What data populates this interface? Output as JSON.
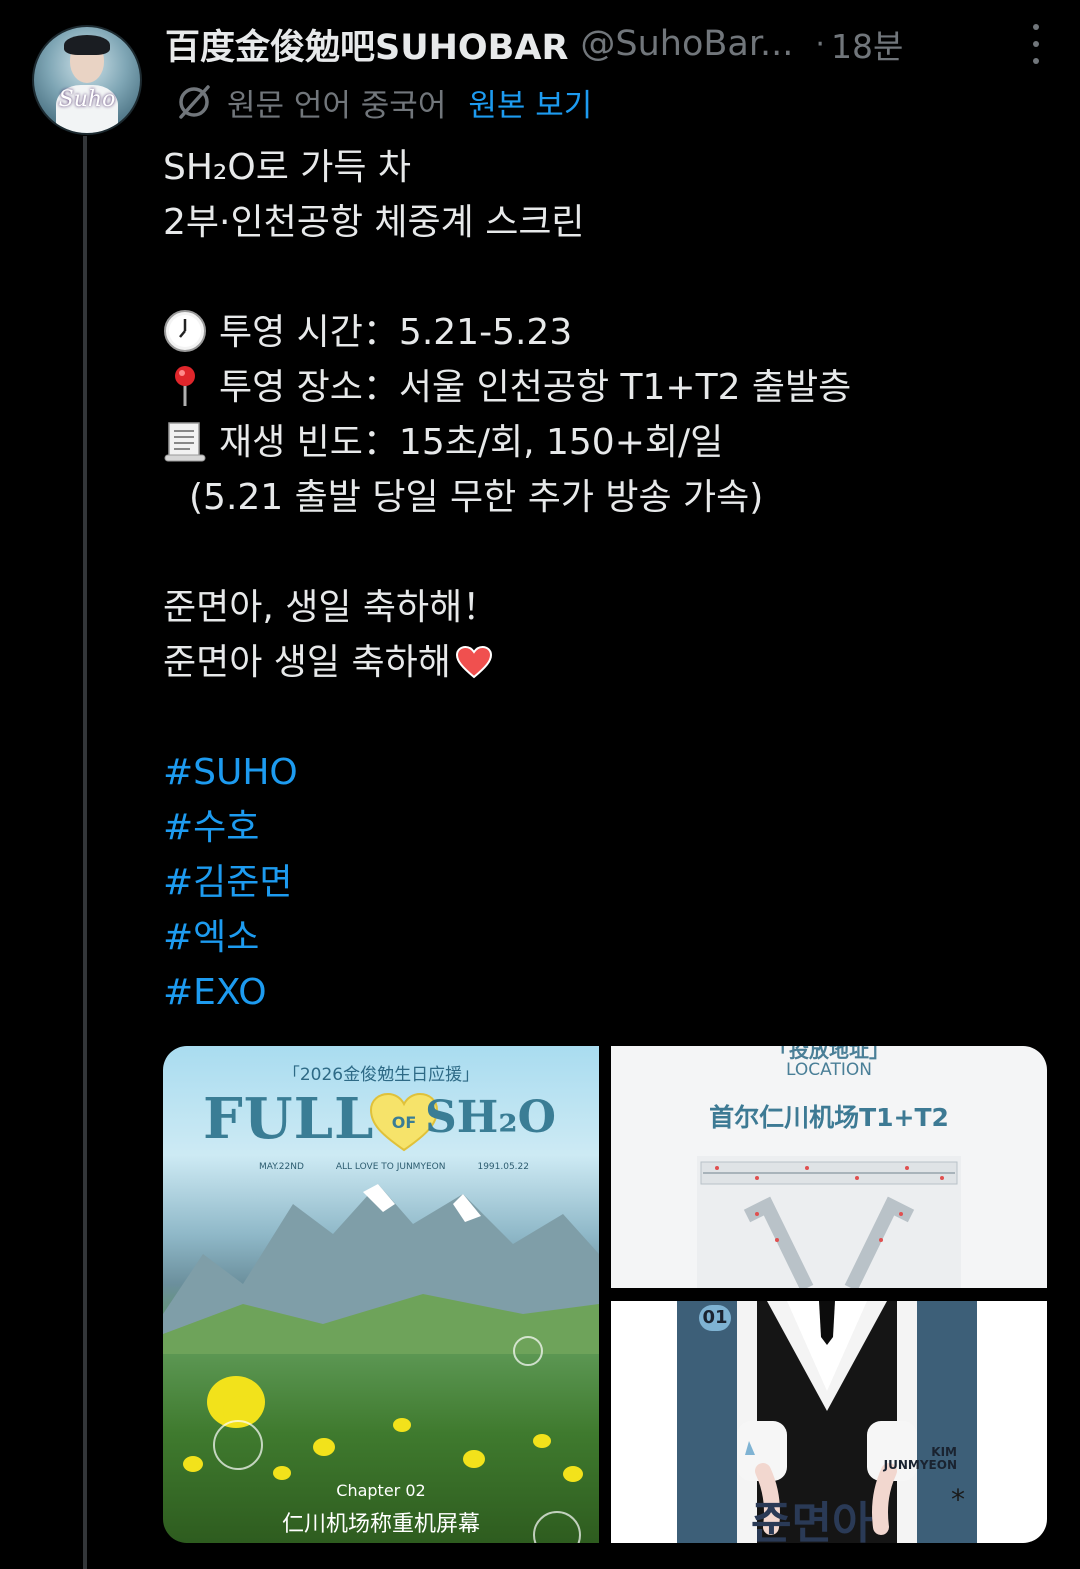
{
  "author": {
    "display_name": "百度金俊勉吧SUHOBAR",
    "handle": "@SuhoBar...",
    "time_separator": "·",
    "time": "18분",
    "avatar_signature": "Suho"
  },
  "translation": {
    "note": "원문 언어 중국어",
    "show_original": "원본 보기"
  },
  "tweet": {
    "title_line1": "SH₂O로 가득 차",
    "title_line2": "2부·인천공항 체중계 스크린",
    "time_line": "투영 시간：5.21-5.23",
    "place_line": "투영 장소：서울 인천공항 T1+T2 출발층",
    "freq_line": "재생 빈도：15초/회, 150+회/일",
    "freq_note": "(5.21 출발 당일 무한 추가 방송 가속)",
    "wish_line1": "준면아, 생일 축하해！",
    "wish_line2": "준면아 생일 축하해",
    "hashtags": [
      "#SUHO",
      "#수호",
      "#김준면",
      "#엑소",
      "#EXO"
    ]
  },
  "media": {
    "poster": {
      "tag": "「2026金俊勉生日应援」",
      "title_left": "FULL",
      "title_of": "OF",
      "title_right": "SH₂O",
      "meta_date": "MAY.22ND",
      "meta_love": "ALL LOVE TO JUNMYEON",
      "meta_year": "1991.05.22",
      "chapter": "Chapter 02",
      "screen_title": "仁川机场称重机屏幕"
    },
    "location": {
      "label_cn": "「投放地址」",
      "label_en": "LOCATION",
      "address": "首尔仁川机场T1+T2"
    },
    "portrait": {
      "number": "01",
      "kim_line1": "KIM",
      "kim_line2": "JUNMYEON",
      "name_big": "준면아",
      "star": "*"
    }
  },
  "icons": {
    "clock": "clock-emoji",
    "pin": "pushpin-emoji",
    "scroll": "scroll-emoji",
    "heart": "red-heart-emoji",
    "translate": "translate-icon",
    "more": "more-icon"
  },
  "colors": {
    "background": "#000000",
    "text": "#e7e9ea",
    "muted": "#71767b",
    "link": "#1d9bf0"
  }
}
